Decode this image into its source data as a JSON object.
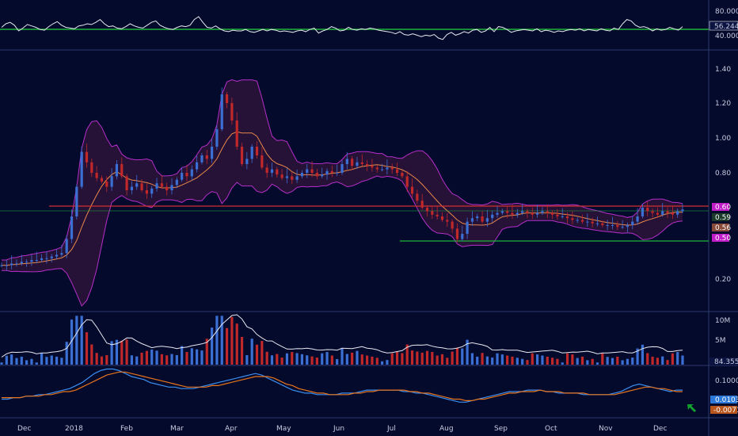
{
  "colors": {
    "background": "#030a2c",
    "separator": "#2e3a6e",
    "up": "#3b6fd4",
    "down": "#c0282a",
    "band": "#b62fc9",
    "band_fill": "#2a1238",
    "ma": "#e8894a",
    "white_line": "#e8e8f0",
    "support": "#1fb53a",
    "resistance": "#d03030",
    "macd": "#3b8ef0",
    "signal": "#e8741d",
    "arrow": "#12a32c"
  },
  "chart_data": [
    {
      "panel": "oscillator",
      "type": "line",
      "ylim": [
        0,
        100
      ],
      "tick_labels": [
        "80.0000",
        "40.0000"
      ],
      "tick_values": [
        80,
        40
      ],
      "last_value_label": "56.2444",
      "last_value": 56.2444,
      "reference_line": 48,
      "series": [
        {
          "values": [
            55,
            60,
            62,
            58,
            50,
            54,
            59,
            57,
            55,
            52,
            51,
            56,
            60,
            63,
            58,
            55,
            54,
            53,
            57,
            58,
            60,
            59,
            62,
            66,
            60,
            56,
            57,
            54,
            53,
            56,
            60,
            57,
            55,
            54,
            58,
            62,
            64,
            58,
            55,
            53,
            52,
            55,
            57,
            56,
            58,
            66,
            70,
            62,
            55,
            54,
            57,
            53,
            50,
            49,
            51,
            50,
            50,
            52,
            49,
            48,
            50,
            52,
            50,
            52,
            51,
            49,
            50,
            49,
            48,
            50,
            51,
            49,
            52,
            54,
            47,
            50,
            52,
            56,
            54,
            50,
            51,
            55,
            52,
            51,
            53,
            52,
            54,
            53,
            51,
            50,
            49,
            48,
            46,
            49,
            45,
            44,
            46,
            44,
            42,
            44,
            43,
            45,
            40,
            38,
            45,
            48,
            44,
            46,
            49,
            47,
            51,
            52,
            48,
            50,
            55,
            49,
            56,
            55,
            52,
            48,
            50,
            51,
            52,
            51,
            50,
            53,
            49,
            51,
            50,
            48,
            50,
            49,
            51,
            52,
            51,
            53,
            50,
            52,
            51,
            50,
            53,
            51,
            50,
            54,
            52,
            60,
            66,
            64,
            58,
            55,
            56,
            54,
            50,
            53,
            51,
            52,
            55,
            53,
            51,
            56
          ]
        }
      ]
    },
    {
      "panel": "price",
      "type": "candlestick",
      "ylim": [
        0.0,
        1.5
      ],
      "y_ticks": [
        1.4,
        1.2,
        1.0,
        0.8,
        0.2
      ],
      "y_tick_labels": [
        "1.40",
        "1.20",
        "1.00",
        "0.80",
        "0.20"
      ],
      "x_tick_labels": [
        "Dec",
        "2018",
        "Feb",
        "Mar",
        "Apr",
        "May",
        "Jun",
        "Jul",
        "Aug",
        "Sep",
        "Oct",
        "Nov",
        "Dec"
      ],
      "price_tags": [
        {
          "label": "0.60",
          "value": 0.6,
          "color": "#c21cc8"
        },
        {
          "label": "0.59",
          "value": 0.59,
          "color": "#1b3a2a"
        },
        {
          "label": "0.56",
          "value": 0.56,
          "color": "#8a4a3a"
        },
        {
          "label": "0.50",
          "value": 0.5,
          "color": "#c21cc8"
        }
      ],
      "resistance": 0.6,
      "support": 0.48,
      "close": [
        0.27,
        0.27,
        0.28,
        0.28,
        0.29,
        0.29,
        0.3,
        0.3,
        0.31,
        0.31,
        0.32,
        0.33,
        0.34,
        0.42,
        0.55,
        0.72,
        0.92,
        0.86,
        0.8,
        0.77,
        0.75,
        0.72,
        0.78,
        0.85,
        0.78,
        0.7,
        0.72,
        0.74,
        0.7,
        0.68,
        0.71,
        0.74,
        0.72,
        0.7,
        0.73,
        0.76,
        0.8,
        0.78,
        0.82,
        0.86,
        0.9,
        0.88,
        0.95,
        1.05,
        1.25,
        1.2,
        1.1,
        0.95,
        0.85,
        0.88,
        0.95,
        0.9,
        0.83,
        0.8,
        0.82,
        0.79,
        0.77,
        0.78,
        0.76,
        0.78,
        0.8,
        0.82,
        0.8,
        0.78,
        0.79,
        0.81,
        0.8,
        0.8,
        0.85,
        0.88,
        0.84,
        0.86,
        0.85,
        0.84,
        0.83,
        0.82,
        0.82,
        0.83,
        0.82,
        0.8,
        0.78,
        0.72,
        0.68,
        0.64,
        0.6,
        0.58,
        0.56,
        0.55,
        0.53,
        0.52,
        0.48,
        0.42,
        0.45,
        0.52,
        0.54,
        0.55,
        0.52,
        0.54,
        0.56,
        0.57,
        0.58,
        0.57,
        0.56,
        0.57,
        0.58,
        0.57,
        0.56,
        0.57,
        0.58,
        0.57,
        0.56,
        0.55,
        0.55,
        0.54,
        0.53,
        0.53,
        0.52,
        0.52,
        0.51,
        0.51,
        0.5,
        0.5,
        0.5,
        0.49,
        0.49,
        0.5,
        0.52,
        0.55,
        0.6,
        0.58,
        0.57,
        0.56,
        0.58,
        0.57,
        0.56,
        0.58,
        0.59
      ]
    },
    {
      "panel": "volume",
      "type": "bar",
      "ylim": [
        0,
        12
      ],
      "y_ticks": [
        10,
        5
      ],
      "y_tick_labels": [
        "10M",
        "5M"
      ],
      "last_value_label": "84.355K",
      "last_value": 0.084355,
      "average_line": 3.0
    },
    {
      "panel": "macd",
      "type": "line",
      "ylim": [
        -0.15,
        0.15
      ],
      "y_ticks": [
        0.1
      ],
      "y_tick_labels": [
        "0.1000"
      ],
      "tags": [
        {
          "label": "0.0103",
          "value": 0.0103,
          "color": "#2c78d9"
        },
        {
          "label": "-0.0071",
          "value": -0.0071,
          "color": "#b8561e"
        }
      ],
      "series": [
        {
          "values": [
            -0.05,
            -0.05,
            -0.04,
            -0.04,
            -0.03,
            -0.03,
            -0.02,
            -0.02,
            -0.01,
            0.0,
            0.01,
            0.02,
            0.04,
            0.06,
            0.09,
            0.12,
            0.14,
            0.15,
            0.15,
            0.14,
            0.12,
            0.1,
            0.09,
            0.08,
            0.06,
            0.05,
            0.04,
            0.03,
            0.03,
            0.02,
            0.02,
            0.02,
            0.03,
            0.04,
            0.05,
            0.06,
            0.07,
            0.08,
            0.09,
            0.1,
            0.11,
            0.12,
            0.11,
            0.09,
            0.07,
            0.05,
            0.03,
            0.01,
            0.0,
            -0.01,
            -0.01,
            -0.02,
            -0.02,
            -0.02,
            -0.02,
            -0.01,
            -0.01,
            -0.01,
            0.0,
            0.01,
            0.01,
            0.01,
            0.01,
            0.01,
            0.01,
            0.0,
            0.0,
            -0.01,
            -0.01,
            -0.02,
            -0.03,
            -0.04,
            -0.05,
            -0.06,
            -0.07,
            -0.07,
            -0.06,
            -0.05,
            -0.04,
            -0.03,
            -0.02,
            -0.01,
            0.0,
            0.0,
            0.0,
            0.01,
            0.01,
            0.01,
            0.0,
            0.0,
            -0.01,
            -0.01,
            -0.01,
            -0.01,
            -0.02,
            -0.02,
            -0.02,
            -0.02,
            -0.02,
            -0.01,
            0.0,
            0.02,
            0.04,
            0.05,
            0.04,
            0.03,
            0.02,
            0.01,
            0.0,
            0.01,
            0.01
          ]
        },
        {
          "values": [
            -0.04,
            -0.04,
            -0.04,
            -0.04,
            -0.03,
            -0.03,
            -0.03,
            -0.02,
            -0.02,
            -0.01,
            0.0,
            0.0,
            0.01,
            0.03,
            0.05,
            0.07,
            0.09,
            0.11,
            0.12,
            0.13,
            0.13,
            0.12,
            0.11,
            0.1,
            0.09,
            0.08,
            0.07,
            0.06,
            0.05,
            0.04,
            0.03,
            0.03,
            0.03,
            0.03,
            0.04,
            0.04,
            0.05,
            0.06,
            0.07,
            0.08,
            0.09,
            0.1,
            0.1,
            0.1,
            0.09,
            0.07,
            0.05,
            0.04,
            0.02,
            0.01,
            0.0,
            -0.01,
            -0.01,
            -0.02,
            -0.02,
            -0.02,
            -0.02,
            -0.01,
            -0.01,
            0.0,
            0.0,
            0.01,
            0.01,
            0.01,
            0.01,
            0.01,
            0.0,
            0.0,
            -0.01,
            -0.01,
            -0.02,
            -0.03,
            -0.04,
            -0.05,
            -0.05,
            -0.06,
            -0.06,
            -0.05,
            -0.05,
            -0.04,
            -0.03,
            -0.02,
            -0.01,
            -0.01,
            0.0,
            0.0,
            0.0,
            0.01,
            0.0,
            0.0,
            0.0,
            -0.01,
            -0.01,
            -0.01,
            -0.01,
            -0.02,
            -0.02,
            -0.02,
            -0.02,
            -0.02,
            -0.01,
            0.0,
            0.01,
            0.02,
            0.03,
            0.03,
            0.02,
            0.02,
            0.01,
            0.0,
            0.0
          ]
        }
      ]
    }
  ]
}
